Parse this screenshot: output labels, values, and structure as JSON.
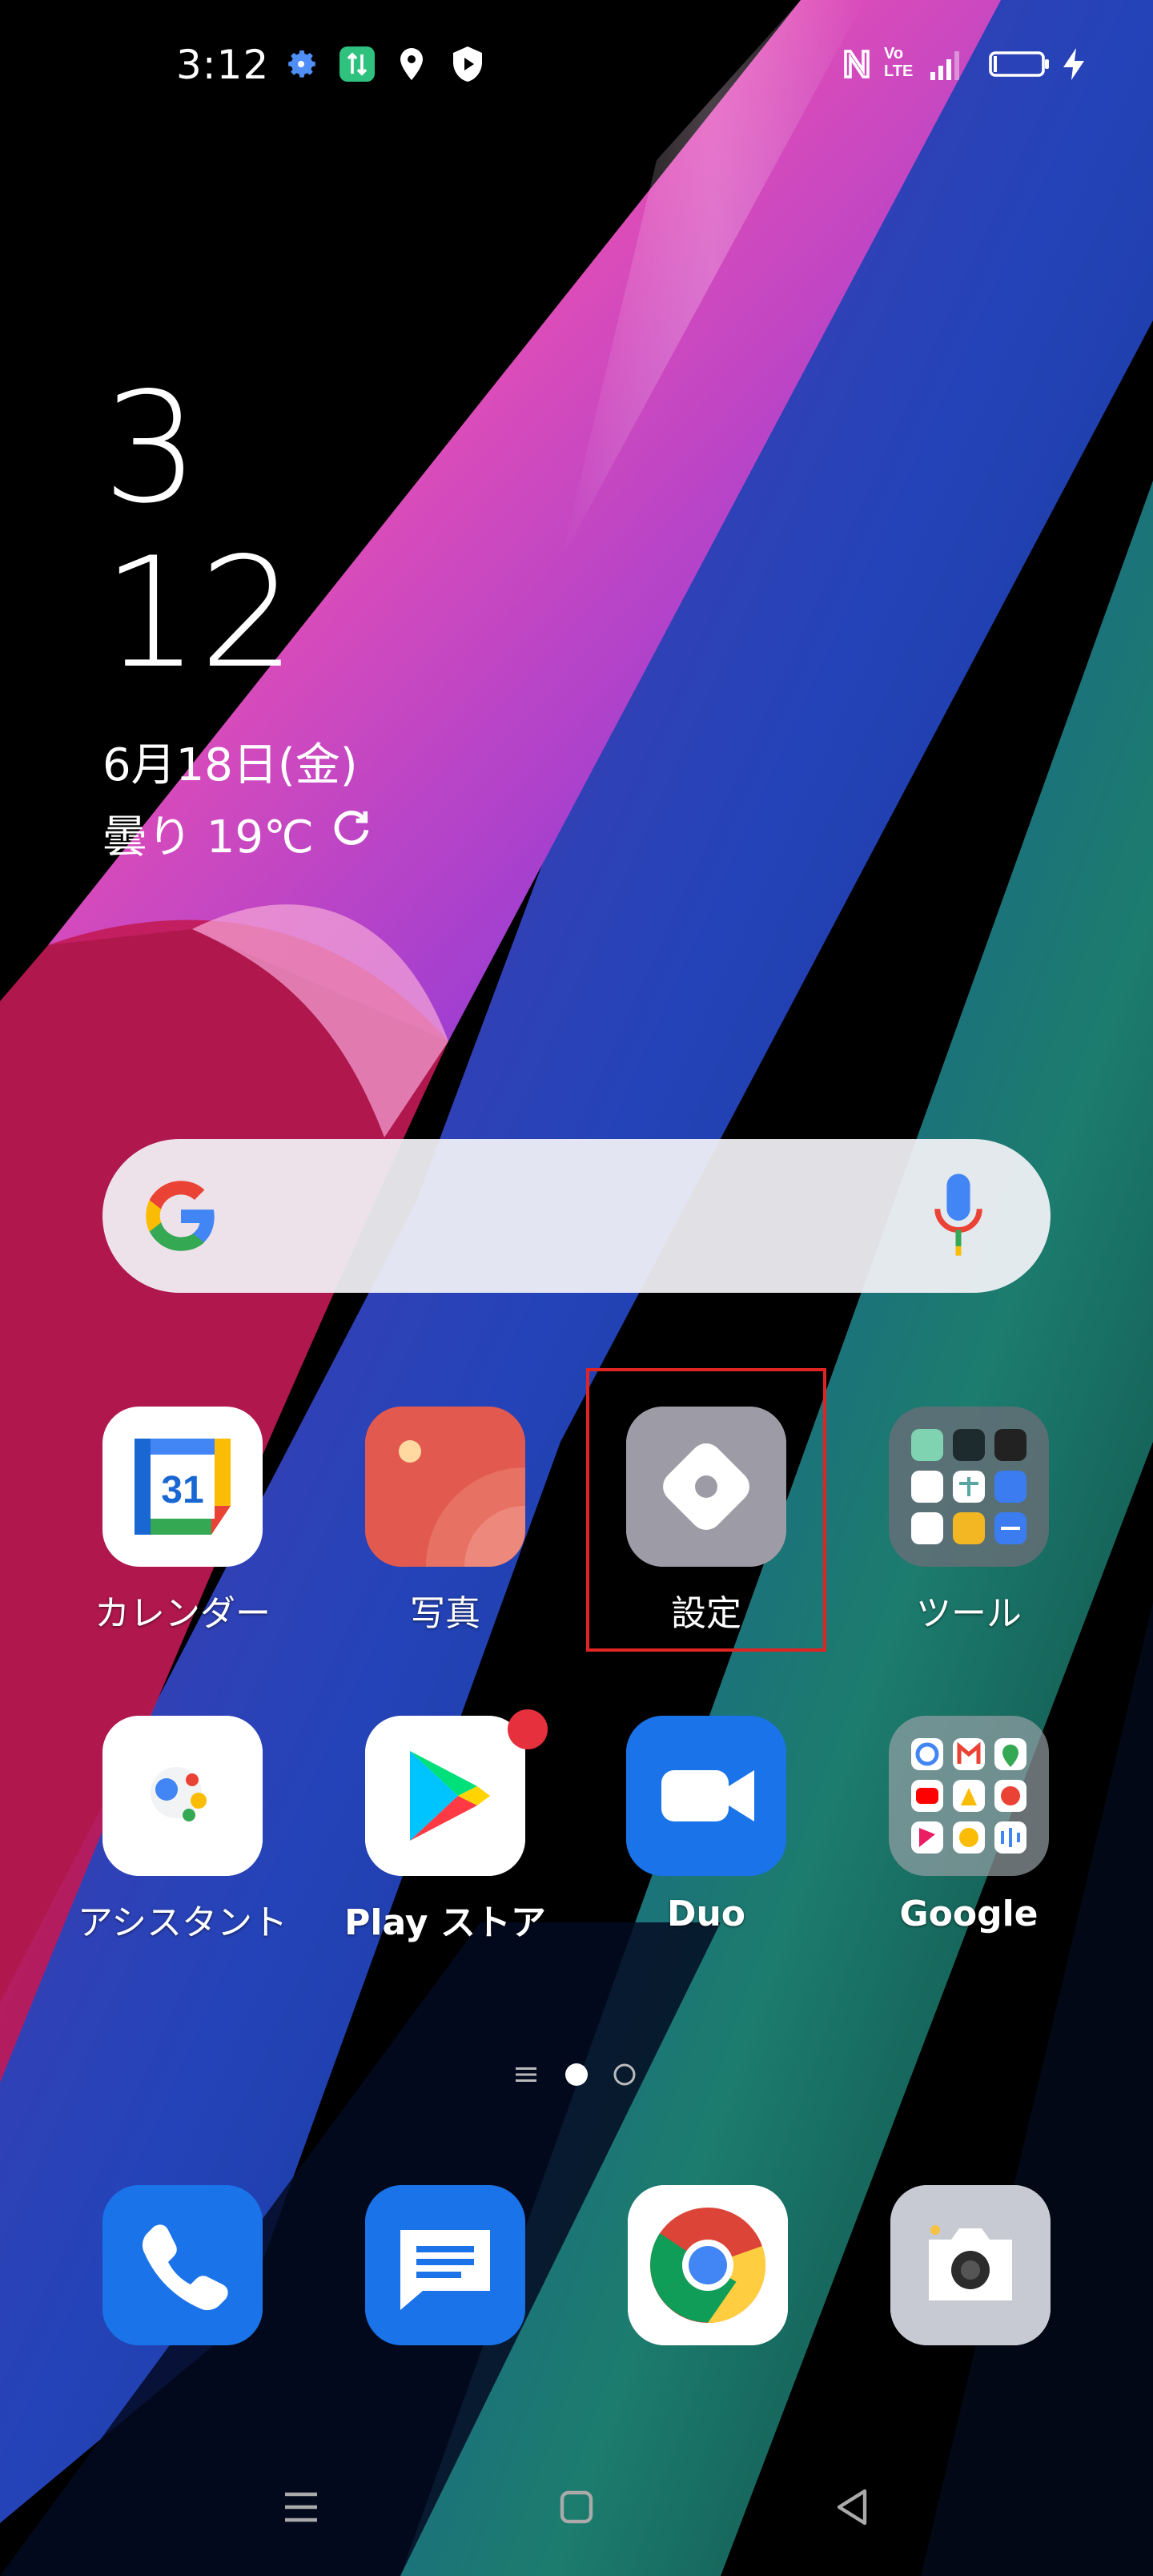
{
  "status_bar": {
    "time": "3:12",
    "icons_left": [
      "gear-icon",
      "data-transfer-icon",
      "location-icon",
      "shield-icon"
    ],
    "icons_right": [
      "nfc-icon",
      "volte-icon",
      "signal-icon",
      "battery-icon",
      "charging-icon"
    ],
    "volte_label_top": "Vo",
    "volte_label_bottom": "LTE"
  },
  "clock_widget": {
    "hour": "3",
    "minute": "12",
    "date": "6月18日(金)",
    "weather": "曇り 19℃"
  },
  "search": {
    "engine": "Google",
    "mic_label": "voice-search"
  },
  "apps_row1": [
    {
      "label": "カレンダー",
      "icon": "calendar-icon",
      "calendar_day": "31"
    },
    {
      "label": "写真",
      "icon": "photos-icon"
    },
    {
      "label": "設定",
      "icon": "settings-icon"
    },
    {
      "label": "ツール",
      "icon": "folder-tools-icon"
    }
  ],
  "apps_row2": [
    {
      "label": "アシスタント",
      "icon": "assistant-icon"
    },
    {
      "label": "Play ストア",
      "icon": "play-store-icon",
      "has_badge": true
    },
    {
      "label": "Duo",
      "icon": "duo-icon"
    },
    {
      "label": "Google",
      "icon": "folder-google-icon"
    }
  ],
  "page_indicator": {
    "pages": 2,
    "current": 1
  },
  "dock": [
    {
      "name": "phone",
      "icon": "phone-icon"
    },
    {
      "name": "messages",
      "icon": "messages-icon"
    },
    {
      "name": "chrome",
      "icon": "chrome-icon"
    },
    {
      "name": "camera",
      "icon": "camera-icon"
    }
  ],
  "nav_bar": [
    "menu-icon",
    "home-icon",
    "back-icon"
  ],
  "colors": {
    "highlight": "#e02424",
    "badge": "#e6303d",
    "search_bg": "#f2f2f6"
  }
}
